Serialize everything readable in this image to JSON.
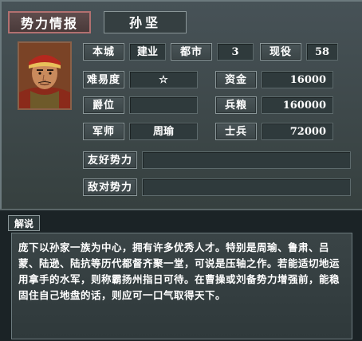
{
  "header": {
    "title": "势力情报",
    "ruler_name": "孙坚"
  },
  "portrait": {
    "subject": "孙坚 portrait",
    "icon": "general-portrait"
  },
  "info": {
    "capital_label": "本城",
    "capital_value": "建业",
    "cities_label": "都市",
    "cities_value": "3",
    "officers_label": "现役",
    "officers_value": "58",
    "difficulty_label": "难易度",
    "difficulty_value": "☆",
    "funds_label": "资金",
    "funds_value": "16000",
    "rank_label": "爵位",
    "rank_value": "",
    "food_label": "兵粮",
    "food_value": "160000",
    "strategist_label": "军师",
    "strategist_value": "周瑜",
    "troops_label": "士兵",
    "troops_value": "72000",
    "allies_label": "友好势力",
    "allies_value": "",
    "enemies_label": "敌对势力",
    "enemies_value": ""
  },
  "description": {
    "tab_label": "解说",
    "text": "庞下以孙家一族为中心，拥有许多优秀人才。特别是周瑜、鲁肃、吕蒙、陆逊、陆抗等历代都督齐聚一堂，可说是压轴之作。若能适切地运用拿手的水军，则称霸扬州指日可待。在曹操或刘备势力增强前，能稳固住自己地盘的话，则应可一口气取得天下。"
  },
  "colors": {
    "panel_bg": "#3a4448",
    "title_border": "#b27070",
    "text": "#ffffff"
  }
}
